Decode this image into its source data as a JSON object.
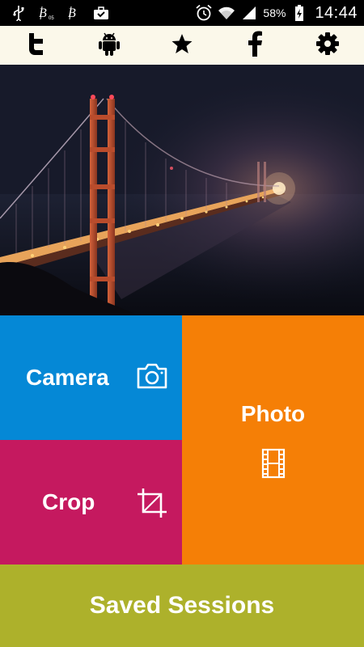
{
  "status_bar": {
    "left_icons": [
      "usb-icon",
      "notification-b-icon",
      "notification-b2-icon",
      "briefcase-icon"
    ],
    "right_icons": [
      "alarm-icon",
      "wifi-icon",
      "signal-icon",
      "battery-icon"
    ],
    "battery_percent": "58%",
    "time": "14:44"
  },
  "toolbar": {
    "items": [
      {
        "name": "twitter-icon"
      },
      {
        "name": "android-icon"
      },
      {
        "name": "star-icon"
      },
      {
        "name": "facebook-icon"
      },
      {
        "name": "gear-icon"
      }
    ]
  },
  "hero": {
    "subject": "bridge-photo"
  },
  "tiles": {
    "camera": {
      "label": "Camera",
      "icon": "camera-icon",
      "color": "#0588d6"
    },
    "crop": {
      "label": "Crop",
      "icon": "crop-icon",
      "color": "#c5195f"
    },
    "photo": {
      "label": "Photo",
      "icon": "film-icon",
      "color": "#f57f06"
    },
    "saved": {
      "label": "Saved Sessions",
      "color": "#adb12b"
    }
  },
  "colors": {
    "toolbar_bg": "#fbf8ea",
    "status_bar_bg": "#000000"
  }
}
